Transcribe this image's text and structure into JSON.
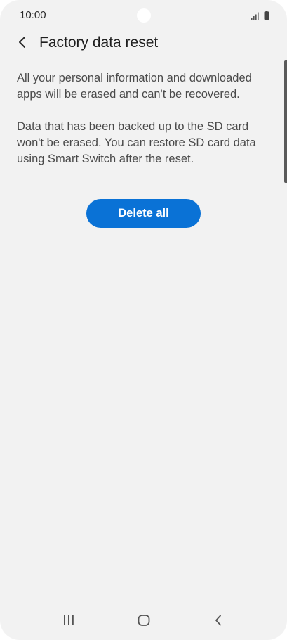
{
  "status_bar": {
    "time": "10:00",
    "icons": [
      "signal-icon",
      "battery-icon"
    ]
  },
  "header": {
    "title": "Factory data reset",
    "back_icon": "chevron-left-icon"
  },
  "content": {
    "paragraph_1": "All your personal information and downloaded apps will be erased and can't be recovered.",
    "paragraph_2": "Data that has been backed up to the SD card won't be erased. You can restore SD card data using Smart Switch after the reset.",
    "delete_button_label": "Delete all"
  },
  "nav_bar": {
    "buttons": [
      "recent-apps-icon",
      "home-icon",
      "back-icon"
    ]
  },
  "colors": {
    "background": "#f2f2f2",
    "accent": "#0a72d6",
    "text_primary": "#1e1e1e",
    "text_secondary": "#4a4a4a"
  }
}
